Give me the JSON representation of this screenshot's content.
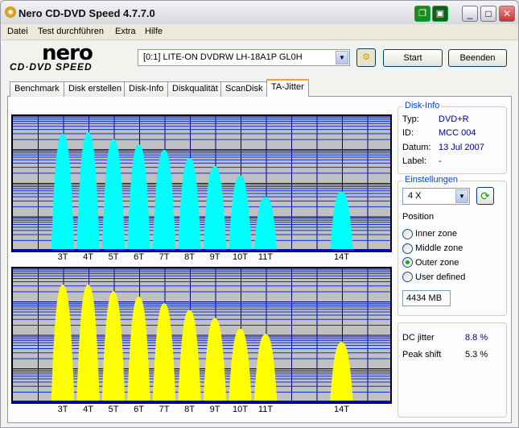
{
  "window": {
    "title": "Nero CD-DVD Speed 4.7.7.0",
    "minimize": "_",
    "maximize": "□",
    "close": "✕"
  },
  "menu": [
    "Datei",
    "Test durchführen",
    "Extra",
    "Hilfe"
  ],
  "logo": {
    "line1": "nero",
    "line2": "CD·DVD SPEED"
  },
  "toolbar": {
    "drive": "[0:1]  LITE-ON DVDRW LH-18A1P GL0H",
    "start": "Start",
    "stop": "Beenden"
  },
  "tabs": [
    "Benchmark",
    "Disk erstellen",
    "Disk-Info",
    "Diskqualität",
    "ScanDisk",
    "TA-Jitter"
  ],
  "active_tab": "TA-Jitter",
  "disk_info": {
    "title": "Disk-Info",
    "rows": [
      {
        "label": "Typ:",
        "value": "DVD+R"
      },
      {
        "label": "ID:",
        "value": "MCC 004"
      },
      {
        "label": "Datum:",
        "value": "13 Jul 2007"
      },
      {
        "label": "Label:",
        "value": "-"
      }
    ]
  },
  "settings": {
    "title": "Einstellungen",
    "speed": "4 X",
    "position_label": "Position",
    "options": [
      "Inner zone",
      "Middle zone",
      "Outer zone",
      "User defined"
    ],
    "selected": "Outer zone",
    "size": "4434 MB"
  },
  "results": {
    "dc_jitter_label": "DC jitter",
    "dc_jitter": "8.8 %",
    "peak_shift_label": "Peak shift",
    "peak_shift": "5.3 %"
  },
  "chart_data": [
    {
      "type": "area",
      "name": "top-histogram",
      "color": "#00ffff",
      "categories": [
        "3T",
        "4T",
        "5T",
        "6T",
        "7T",
        "8T",
        "9T",
        "10T",
        "11T",
        "14T"
      ],
      "peaks": [
        0.87,
        0.88,
        0.83,
        0.79,
        0.75,
        0.69,
        0.63,
        0.56,
        0.4,
        0.44
      ],
      "yscale": "log"
    },
    {
      "type": "area",
      "name": "bottom-histogram",
      "color": "#ffff00",
      "categories": [
        "3T",
        "4T",
        "5T",
        "6T",
        "7T",
        "8T",
        "9T",
        "10T",
        "11T",
        "14T"
      ],
      "peaks": [
        0.88,
        0.88,
        0.83,
        0.79,
        0.74,
        0.69,
        0.63,
        0.55,
        0.51,
        0.45
      ],
      "yscale": "log"
    }
  ]
}
